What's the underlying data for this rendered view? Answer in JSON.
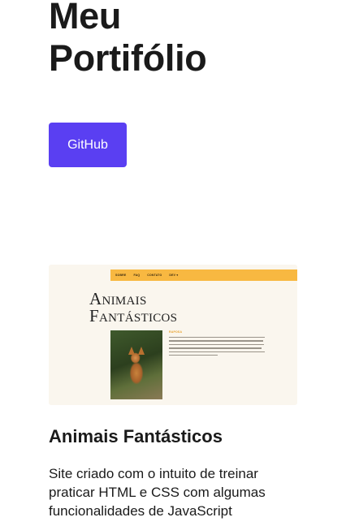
{
  "header": {
    "title_line1": "Meu",
    "title_line2": "Portifólio",
    "github_label": "GitHub"
  },
  "project": {
    "preview": {
      "nav_items": [
        "Sobre",
        "FAQ",
        "Contato",
        "Dev ▾"
      ],
      "heading_line1": "Animais",
      "heading_line2": "Fantásticos",
      "subtitle": "Raposa"
    },
    "title": "Animais Fantásticos",
    "description": "Site criado com o intuito de treinar praticar HTML e CSS com algumas funcionalidades de JavaScript"
  },
  "colors": {
    "accent": "#5a3ff2",
    "text": "#1a1a1a",
    "preview_nav": "#f8b841",
    "preview_bg": "#faf6ee"
  }
}
